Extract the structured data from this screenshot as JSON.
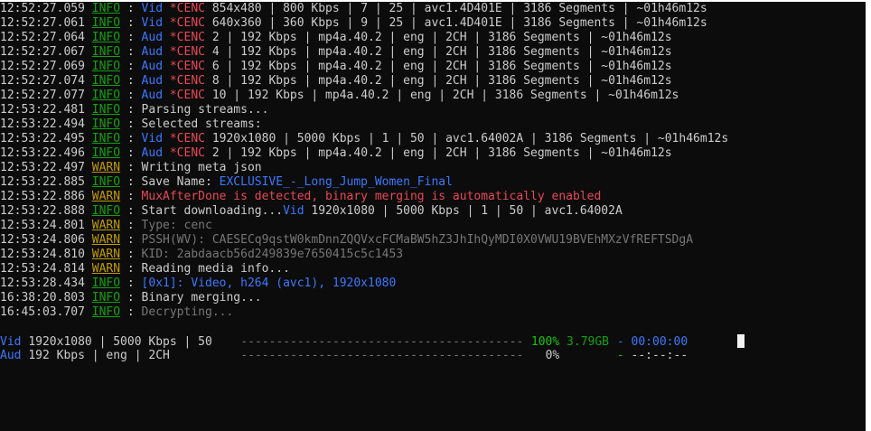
{
  "log": [
    {
      "ts": "12:52:27.059",
      "level": "INFO",
      "type": "Vid",
      "cenc": "*CENC",
      "text": "854x480 | 800 Kbps | 7 | 25 | avc1.4D401E | 3186 Segments | ~01h46m12s"
    },
    {
      "ts": "12:52:27.061",
      "level": "INFO",
      "type": "Vid",
      "cenc": "*CENC",
      "text": "640x360 | 360 Kbps | 9 | 25 | avc1.4D401E | 3186 Segments | ~01h46m12s"
    },
    {
      "ts": "12:52:27.064",
      "level": "INFO",
      "type": "Aud",
      "cenc": "*CENC",
      "text": "2 | 192 Kbps | mp4a.40.2 | eng | 2CH | 3186 Segments | ~01h46m12s"
    },
    {
      "ts": "12:52:27.067",
      "level": "INFO",
      "type": "Aud",
      "cenc": "*CENC",
      "text": "4 | 192 Kbps | mp4a.40.2 | eng | 2CH | 3186 Segments | ~01h46m12s"
    },
    {
      "ts": "12:52:27.069",
      "level": "INFO",
      "type": "Aud",
      "cenc": "*CENC",
      "text": "6 | 192 Kbps | mp4a.40.2 | eng | 2CH | 3186 Segments | ~01h46m12s"
    },
    {
      "ts": "12:52:27.074",
      "level": "INFO",
      "type": "Aud",
      "cenc": "*CENC",
      "text": "8 | 192 Kbps | mp4a.40.2 | eng | 2CH | 3186 Segments | ~01h46m12s"
    },
    {
      "ts": "12:52:27.077",
      "level": "INFO",
      "type": "Aud",
      "cenc": "*CENC",
      "text": "10 | 192 Kbps | mp4a.40.2 | eng | 2CH | 3186 Segments | ~01h46m12s"
    },
    {
      "ts": "12:53:22.481",
      "level": "INFO",
      "msg": "Parsing streams...",
      "msg_color": "white"
    },
    {
      "ts": "12:53:22.494",
      "level": "INFO",
      "msg": "Selected streams:",
      "msg_color": "white"
    },
    {
      "ts": "12:53:22.495",
      "level": "INFO",
      "type": "Vid",
      "cenc": "*CENC",
      "text": "1920x1080 | 5000 Kbps | 1 | 50 | avc1.64002A | 3186 Segments | ~01h46m12s"
    },
    {
      "ts": "12:53:22.496",
      "level": "INFO",
      "type": "Aud",
      "cenc": "*CENC",
      "text": "2 | 192 Kbps | mp4a.40.2 | eng | 2CH | 3186 Segments | ~01h46m12s"
    },
    {
      "ts": "12:53:22.497",
      "level": "WARN",
      "msg": "Writing meta json",
      "msg_color": "white"
    },
    {
      "ts": "12:53:22.885",
      "level": "INFO",
      "prefix": "Save Name: ",
      "msg": "EXCLUSIVE_-_Long_Jump_Women_Final",
      "msg_color": "blue"
    },
    {
      "ts": "12:53:22.886",
      "level": "WARN",
      "msg": "MuxAfterDone is detected, binary merging is automatically enabled",
      "msg_color": "red"
    },
    {
      "ts": "12:53:22.888",
      "level": "INFO",
      "prefix": "Start downloading...",
      "type": "Vid",
      "text": "1920x1080 | 5000 Kbps | 1 | 50 | avc1.64002A"
    },
    {
      "ts": "12:53:24.801",
      "level": "WARN",
      "msg": "Type: cenc",
      "msg_color": "gray"
    },
    {
      "ts": "12:53:24.806",
      "level": "WARN",
      "msg": "PSSH(WV): CAESECq9qstW0kmDnnZQQVxcFCMaBW5hZ3JhIhQyMDI0X0VWU19BVEhMXzVfREFTSDgA",
      "msg_color": "gray"
    },
    {
      "ts": "12:53:24.810",
      "level": "WARN",
      "msg": "KID: 2abdaacb56d249839e7650415c5c1453",
      "msg_color": "gray"
    },
    {
      "ts": "12:53:24.814",
      "level": "WARN",
      "msg": "Reading media info...",
      "msg_color": "white"
    },
    {
      "ts": "12:53:28.434",
      "level": "INFO",
      "msg": "[0x1]: Video, h264 (avc1), 1920x1080",
      "msg_color": "blue"
    },
    {
      "ts": "16:38:20.803",
      "level": "INFO",
      "msg": "Binary merging...",
      "msg_color": "white"
    },
    {
      "ts": "16:45:03.707",
      "level": "INFO",
      "msg": "Decrypting...",
      "msg_color": "gray"
    }
  ],
  "progress": [
    {
      "type": "Vid",
      "desc": "1920x1080 | 5000 Kbps | 50",
      "bar": "----------------------------------------",
      "percent": "100%",
      "size": "3.79GB",
      "sep": "-",
      "time": "00:00:00",
      "done": true
    },
    {
      "type": "Aud",
      "desc": "192 Kbps | eng | 2CH",
      "bar": "----------------------------------------",
      "percent": "0%",
      "size": "",
      "sep": "-",
      "time": "--:--:--",
      "done": false
    }
  ],
  "colors": {
    "background": "#0c0c0c",
    "info": "#13a10e",
    "warn": "#c19c00",
    "type": "#3b78ff",
    "cenc": "#e74856"
  }
}
